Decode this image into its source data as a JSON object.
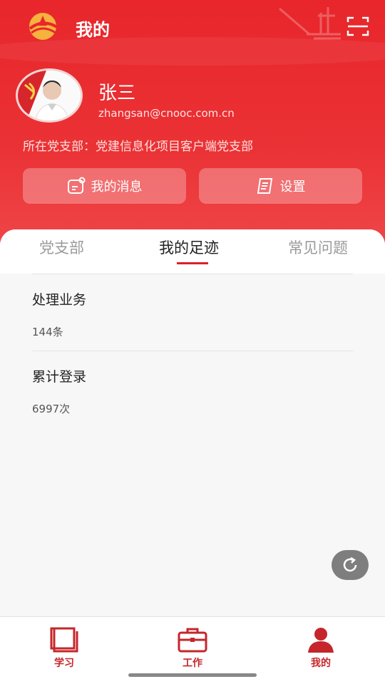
{
  "header": {
    "title": "我的",
    "logo_icon": "party-logo-icon",
    "scan_icon": "scan-icon"
  },
  "user": {
    "name": "张三",
    "email": "zhangsan@cnooc.com.cn",
    "branch_label": "所在党支部：",
    "branch_name": "党建信息化项目客户端党支部"
  },
  "actions": {
    "messages_label": "我的消息",
    "settings_label": "设置"
  },
  "tabs": [
    {
      "label": "党支部"
    },
    {
      "label": "我的足迹"
    },
    {
      "label": "常见问题"
    }
  ],
  "stats": [
    {
      "title": "处理业务",
      "value": "144条"
    },
    {
      "title": "累计登录",
      "value": "6997次"
    }
  ],
  "nav": [
    {
      "label": "学习",
      "icon": "book-icon"
    },
    {
      "label": "工作",
      "icon": "briefcase-icon"
    },
    {
      "label": "我的",
      "icon": "person-icon"
    }
  ],
  "colors": {
    "primary": "#e8262b",
    "accent_dark": "#c5262b",
    "tab_active": "#222222",
    "tab_inactive": "#9a9a9a"
  }
}
